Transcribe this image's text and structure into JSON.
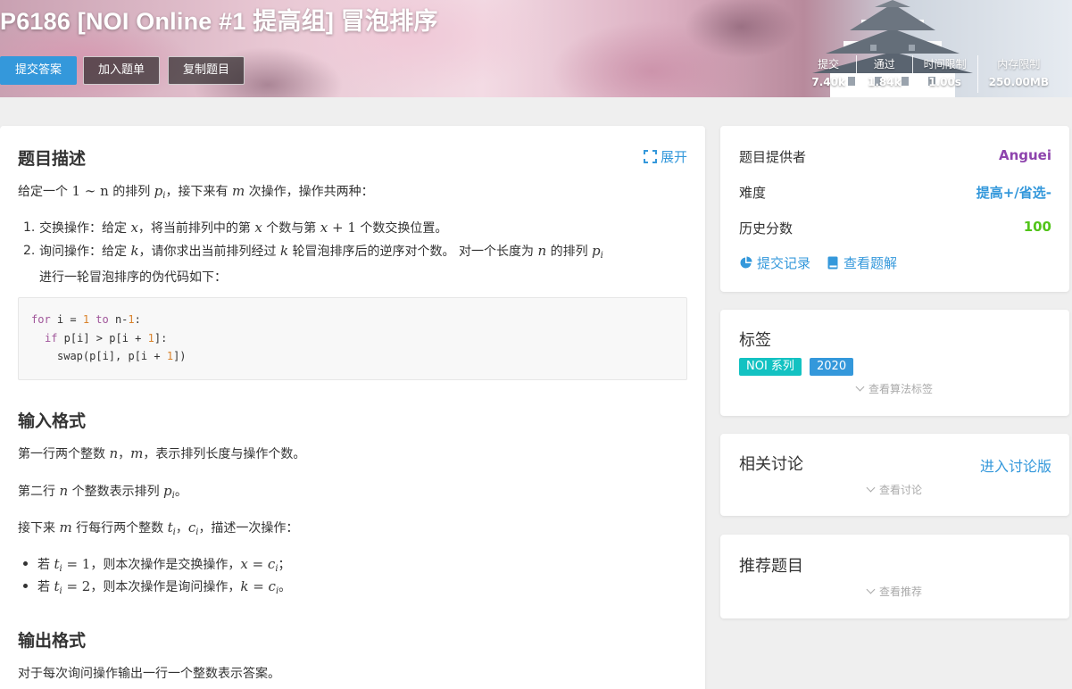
{
  "header": {
    "title": "P6186 [NOI Online #1 提高组] 冒泡排序",
    "buttons": {
      "submit": "提交答案",
      "add_to_list": "加入题单",
      "copy": "复制题目"
    },
    "stats": [
      {
        "label": "提交",
        "value": "7.40k"
      },
      {
        "label": "通过",
        "value": "1.84k"
      },
      {
        "label": "时间限制",
        "value": "1.00s"
      },
      {
        "label": "内存限制",
        "value": "250.00MB"
      }
    ]
  },
  "problem": {
    "description_title": "题目描述",
    "expand_label": "展开",
    "intro_a": "给定一个 ",
    "intro_math1": "1 ∼ n",
    "intro_b": " 的排列 ",
    "intro_c": "，接下来有 ",
    "intro_d": " 次操作，操作共两种：",
    "op1_num": "1.",
    "op1_a": "交换操作：给定 ",
    "op1_b": "，将当前排列中的第 ",
    "op1_c": " 个数与第 ",
    "op1_d": " 个数交换位置。",
    "op2_num": "2.",
    "op2_a": "询问操作：给定 ",
    "op2_b": "，请你求出当前排列经过 ",
    "op2_c": " 轮冒泡排序后的逆序对个数。 对一个长度为 ",
    "op2_d": " 的排列 ",
    "op2_e": "进行一轮冒泡排序的伪代码如下：",
    "code": {
      "line1_kw": "for",
      "line1_a": " i = ",
      "line1_n1": "1",
      "line1_kw2": " to",
      "line1_b": " n-",
      "line1_n2": "1",
      "line1_c": ":",
      "line2_kw": "if",
      "line2_a": " p[i] > p[i + ",
      "line2_n": "1",
      "line2_b": "]:",
      "line3_a": "swap(p[i], p[i + ",
      "line3_n": "1",
      "line3_b": "])"
    },
    "input_title": "输入格式",
    "input_p1_a": "第一行两个整数 ",
    "input_p1_b": "，",
    "input_p1_c": "，表示排列长度与操作个数。",
    "input_p2_a": "第二行 ",
    "input_p2_b": " 个整数表示排列 ",
    "input_p2_c": "。",
    "input_p3_a": "接下来 ",
    "input_p3_b": " 行每行两个整数 ",
    "input_p3_c": "，",
    "input_p3_d": "，描述一次操作：",
    "bullet1_a": "若 ",
    "bullet1_b": "，则本次操作是交换操作，",
    "bullet1_c": "；",
    "bullet2_a": "若 ",
    "bullet2_b": "，则本次操作是询问操作，",
    "bullet2_c": "。",
    "output_title": "输出格式",
    "output_p1": "对于每次询问操作输出一行一个整数表示答案。"
  },
  "info": {
    "provider_label": "题目提供者",
    "provider_value": "Anguei",
    "difficulty_label": "难度",
    "difficulty_value": "提高+/省选-",
    "history_label": "历史分数",
    "history_value": "100",
    "submissions_link": "提交记录",
    "solutions_link": "查看题解"
  },
  "tags": {
    "title": "标签",
    "items": [
      "NOI 系列",
      "2020"
    ],
    "more": "查看算法标签"
  },
  "discussion": {
    "title": "相关讨论",
    "enter": "进入讨论版",
    "more": "查看讨论"
  },
  "recommend": {
    "title": "推荐题目",
    "more": "查看推荐"
  },
  "colors": {
    "accent": "#3498db",
    "provider": "#8e44ad",
    "difficulty": "#3498db",
    "score": "#52c41a",
    "tag_series": "#13c2c2",
    "tag_year": "#3498db"
  }
}
